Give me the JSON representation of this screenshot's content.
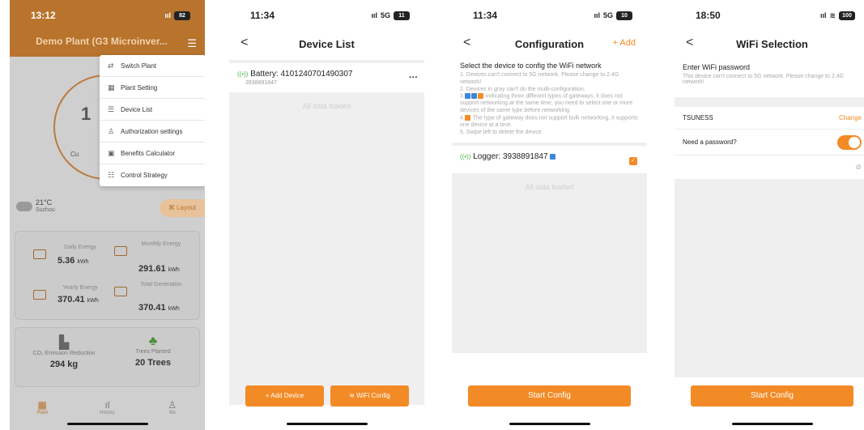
{
  "phone1": {
    "time": "13:12",
    "signal": "ııl",
    "battery": "82",
    "plant_title": "Demo Plant (G3 Microinver...",
    "gauge_number": "1",
    "gauge_sub": "Cu",
    "weather": {
      "temp": "21°C",
      "city": "Suzhou"
    },
    "layout_label": "Layout",
    "menu": [
      {
        "label": "Switch Plant",
        "icon": "⇄"
      },
      {
        "label": "Plant Setting",
        "icon": "▦"
      },
      {
        "label": "Device List",
        "icon": "☰"
      },
      {
        "label": "Authorization settings",
        "icon": "♙"
      },
      {
        "label": "Benefits Calculator",
        "icon": "▣"
      },
      {
        "label": "Control Strategy",
        "icon": "☷"
      }
    ],
    "stats": {
      "daily": {
        "label": "Daily Energy",
        "value": "5.36",
        "unit": "kWh"
      },
      "monthly": {
        "label": "Monthly Energy",
        "value": "291.61",
        "unit": "kWh"
      },
      "yearly": {
        "label": "Yearly Energy",
        "value": "370.41",
        "unit": "kWh"
      },
      "total": {
        "label": "Total Generation",
        "value": "370.41",
        "unit": "kWh"
      }
    },
    "eco": {
      "co2_label": "CO₂ Emission Reduction",
      "co2_value": "294 kg",
      "trees_label": "Trees Planted",
      "trees_value": "20 Trees"
    },
    "tabs": [
      {
        "label": "Plant",
        "icon": "▦"
      },
      {
        "label": "History",
        "icon": "ıl"
      },
      {
        "label": "Me",
        "icon": "♙"
      }
    ]
  },
  "phone2": {
    "time": "11:34",
    "network": "5G",
    "battery": "11",
    "title": "Device List",
    "device": {
      "name": "Battery: 4101240701490307",
      "sub": "3938891847"
    },
    "loaded_text": "All data loaded",
    "add_device": "+ Add Device",
    "wifi_config": "WiFi Config"
  },
  "phone3": {
    "time": "11:34",
    "network": "5G",
    "battery": "10",
    "title": "Configuration",
    "add_label": "+ Add",
    "heading": "Select the device to config the WiFi network",
    "notes": {
      "n1": "1. Devices can't connect to 5G network. Please change to 2.4G network!",
      "n2": "2. Devices in gray can't do the multi-configuration.",
      "n3_prefix": "3.",
      "n3": "indicating three different types of gateways, it does not support networking at the same time, you need to select one or more devices of the same type before networking.",
      "n4_prefix": "4.",
      "n4": "The type of gateway does not support bulk networking, it supports one device at a time.",
      "n5": "5. Swipe left to delete the device."
    },
    "logger": "Logger: 3938891847",
    "loaded_text": "All data loaded",
    "start": "Start Config"
  },
  "phone4": {
    "time": "18:50",
    "battery": "100",
    "title": "WiFi Selection",
    "heading": "Enter WiFi password",
    "note": "This device can't connect to 5G network. Please change to 2.4G network!",
    "ssid": "TSUNESS",
    "change": "Change",
    "need_password": "Need a password?",
    "password_value": "",
    "start": "Start Config"
  },
  "colors": {
    "accent": "#f28b25",
    "header_brown": "#b8732c"
  }
}
